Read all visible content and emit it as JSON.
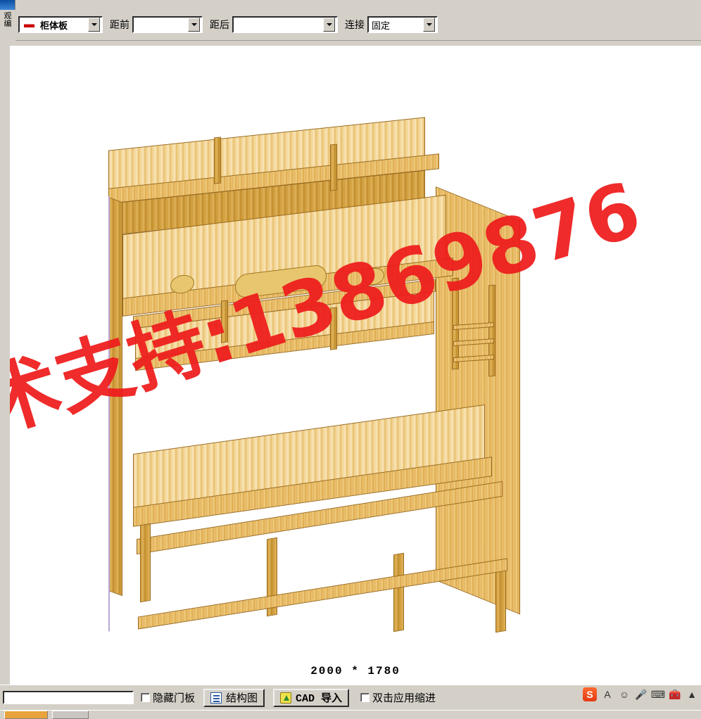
{
  "window": {
    "vertical_label_lines": [
      "观",
      "编"
    ]
  },
  "toolbar": {
    "plate_combo": {
      "icon": "minus-icon",
      "value": "柜体板"
    },
    "front_label": "距前",
    "front_combo_value": "",
    "back_label": "距后",
    "back_combo_value": "",
    "connect_label": "连接",
    "connect_combo_value": "固定"
  },
  "canvas": {
    "dimension_text": "2000 * 1780",
    "watermark_text": "术支持:13869876"
  },
  "statusbar": {
    "input_value": "",
    "hide_door_label": "隐藏门板",
    "structure_button": "结构图",
    "cad_button": "CAD 导入",
    "double_click_label": "双击应用缩进"
  },
  "tray": {
    "items": [
      {
        "name": "sogou-input-icon",
        "glyph": "S"
      },
      {
        "name": "font-a-icon",
        "glyph": "A"
      },
      {
        "name": "smiley-icon",
        "glyph": "☺"
      },
      {
        "name": "microphone-icon",
        "glyph": "🎤"
      },
      {
        "name": "keyboard-icon",
        "glyph": "⌨"
      },
      {
        "name": "toolbox-icon",
        "glyph": "🧰"
      },
      {
        "name": "chevron-up-icon",
        "glyph": "▲"
      }
    ]
  },
  "taskbar": {
    "buttons": [
      "",
      ""
    ]
  }
}
